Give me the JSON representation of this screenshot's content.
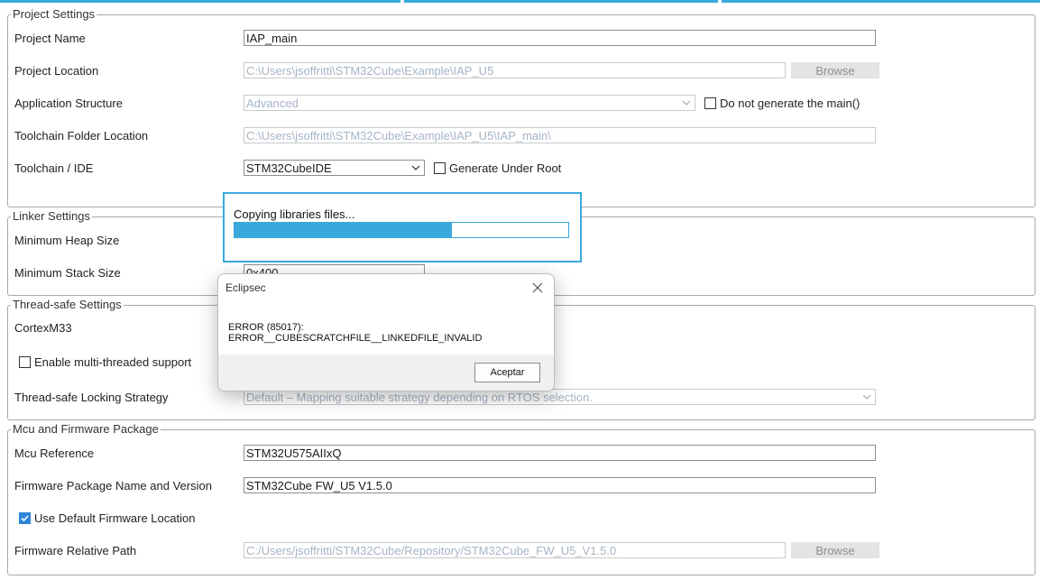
{
  "project_settings": {
    "legend": "Project Settings",
    "project_name_label": "Project Name",
    "project_name_value": "IAP_main",
    "project_location_label": "Project Location",
    "project_location_value": "C:\\Users\\jsoffritti\\STM32Cube\\Example\\IAP_U5",
    "browse_label": "Browse",
    "app_structure_label": "Application Structure",
    "app_structure_value": "Advanced",
    "no_main_label": "Do not generate the main()",
    "toolchain_folder_label": "Toolchain Folder Location",
    "toolchain_folder_value": "C:\\Users\\jsoffritti\\STM32Cube\\Example\\IAP_U5\\IAP_main\\",
    "toolchain_ide_label": "Toolchain / IDE",
    "toolchain_ide_value": "STM32CubeIDE",
    "generate_under_root_label": "Generate Under Root"
  },
  "linker_settings": {
    "legend": "Linker Settings",
    "min_heap_label": "Minimum Heap Size",
    "min_stack_label": "Minimum Stack Size",
    "min_stack_value": "0x400"
  },
  "thread_safe": {
    "legend": "Thread-safe Settings",
    "core_label": "CortexM33",
    "multi_thread_label": "Enable multi-threaded support",
    "locking_label": "Thread-safe Locking Strategy",
    "locking_value": "Default – Mapping suitable strategy depending on RTOS selection."
  },
  "mcu_firmware": {
    "legend": "Mcu and Firmware Package",
    "mcu_ref_label": "Mcu Reference",
    "mcu_ref_value": "STM32U575AIIxQ",
    "fw_name_label": "Firmware Package Name and Version",
    "fw_name_value": "STM32Cube FW_U5 V1.5.0",
    "use_default_label": "Use Default Firmware Location",
    "fw_path_label": "Firmware Relative Path",
    "fw_path_value": "C:/Users/jsoffritti/STM32Cube/Repository/STM32Cube_FW_U5_V1.5.0",
    "browse_label": "Browse"
  },
  "progress_dialog": {
    "message": "Copying libraries files...",
    "progress": 0.65
  },
  "error_dialog": {
    "title": "Eclipsec",
    "message": "ERROR (85017): ERROR__CUBESCRATCHFILE__LINKEDFILE_INVALID",
    "ok_label": "Aceptar"
  },
  "colors": {
    "accent": "#39a9dc",
    "checkbox_on": "#2f86d8"
  }
}
